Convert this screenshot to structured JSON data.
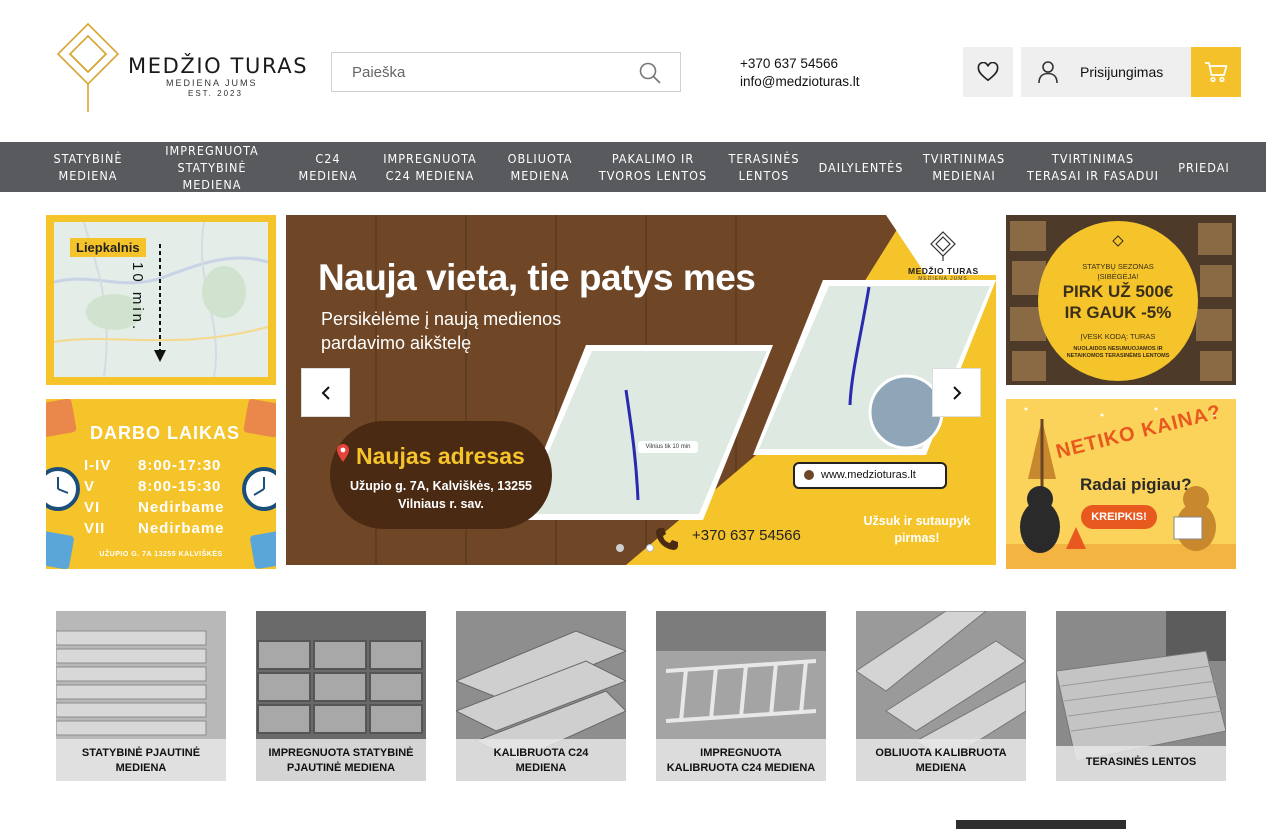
{
  "header": {
    "logo": {
      "title": "MEDŽIO TURAS",
      "subtitle": "MEDIENA JUMS",
      "est": "EST. 2023"
    },
    "search": {
      "placeholder": "Paieška",
      "value": ""
    },
    "contact": {
      "phone": "+370 637 54566",
      "email": "info@medzioturas.lt"
    },
    "login_label": "Prisijungimas"
  },
  "nav": [
    "STATYBINĖ\nMEDIENA",
    "IMPREGNUOTA\nSTATYBINĖ MEDIENA",
    "C24\nMEDIENA",
    "IMPREGNUOTA\nC24 MEDIENA",
    "OBLIUOTA\nMEDIENA",
    "PAKALIMO IR\nTVOROS LENTOS",
    "TERASINĖS\nLENTOS",
    "DAILYLENTĖS",
    "TVIRTINIMAS\nMEDIENAI",
    "TVIRTINIMAS\nTERASAI IR FASADUI",
    "PRIEDAI"
  ],
  "map_banner": {
    "place": "Liepkalnis",
    "time": "10 min."
  },
  "hours_banner": {
    "title": "DARBO LAIKAS",
    "rows": [
      {
        "day": "I-IV",
        "time": "8:00-17:30"
      },
      {
        "day": "V",
        "time": "8:00-15:30"
      },
      {
        "day": "VI",
        "time": "Nedirbame"
      },
      {
        "day": "VII",
        "time": "Nedirbame"
      }
    ],
    "address": "UŽUPIO G. 7A 13255 KALVIŠKĖS"
  },
  "hero": {
    "title": "Nauja vieta, tie patys mes",
    "subtitle": "Persikėlėme į naują medienos pardavimo aikštelę",
    "brand_title": "MEDŽIO TURAS",
    "brand_sub": "MEDIENA JUMS",
    "address_title": "Naujas adresas",
    "address_line1": "Užupio g. 7A, Kalviškės, 13255",
    "address_line2": "Vilniaus r. sav.",
    "route_label": "Vilnius tik 10 min",
    "url": "www.medzioturas.lt",
    "phone": "+370 637 54566",
    "cta": "Užsuk ir sutaupyk pirmas!",
    "active_slide": 1,
    "slide_count": 2
  },
  "promo_banner": {
    "l1": "STATYBŲ SEZONAS",
    "l2": "ĮSIBĖGĖJA!",
    "l3": "PIRK UŽ 500€",
    "l4": "IR GAUK -5%",
    "l5": "ĮVESK KODĄ: TURAS",
    "l6": "NUOLAIDOS NESUMUOJAMOS IR NETAIKOMOS TERASINĖMS LENTOMS"
  },
  "price_banner": {
    "headline": "NETIKO KAINA?",
    "sub": "Radai pigiau?",
    "button": "KREIPKIS!"
  },
  "categories": [
    "STATYBINĖ PJAUTINĖ\nMEDIENA",
    "IMPREGNUOTA  STATYBINĖ\nPJAUTINĖ MEDIENA",
    "KALIBRUOTA C24\nMEDIENA",
    "IMPREGNUOTA\nKALIBRUOTA C24 MEDIENA",
    "OBLIUOTA KALIBRUOTA\nMEDIENA",
    "TERASINĖS LENTOS"
  ],
  "colors": {
    "accent": "#f4c12a",
    "nav_bg": "#585a5d",
    "wood": "#6b4526"
  }
}
